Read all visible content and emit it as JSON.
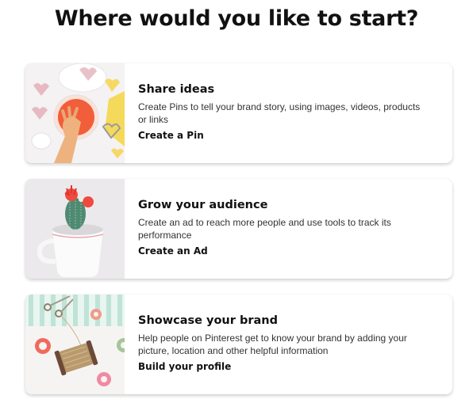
{
  "page": {
    "title": "Where would you like to start?"
  },
  "cards": [
    {
      "title": "Share ideas",
      "description": "Create Pins to tell your brand story, using images, videos, products or links",
      "link_label": "Create a Pin",
      "image": "baking-hearts-photo"
    },
    {
      "title": "Grow your audience",
      "description": "Create an ad to reach more people and use tools to track its performance",
      "link_label": "Create an Ad",
      "image": "cactus-cup-photo"
    },
    {
      "title": "Showcase your brand",
      "description": "Help people on Pinterest get to know your brand by adding your picture, location and other helpful information",
      "link_label": "Build your profile",
      "image": "twine-washi-tape-photo"
    }
  ]
}
